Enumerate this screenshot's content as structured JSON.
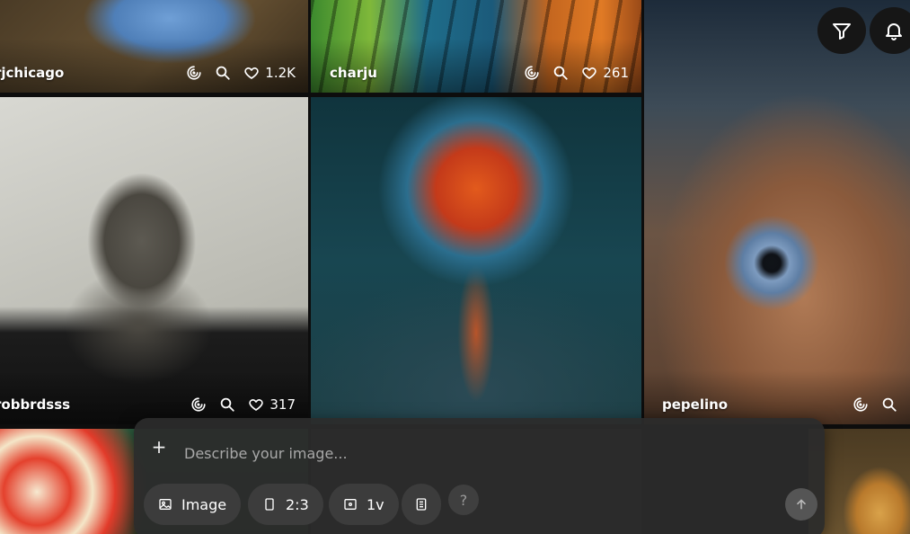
{
  "tiles": [
    {
      "author": "rjchicago",
      "likes": "1.2K"
    },
    {
      "author": "charju",
      "likes": "261"
    },
    {
      "author": "robbrdsss",
      "likes": "317"
    },
    {
      "author": "pepelino",
      "likes": ""
    }
  ],
  "controls": {
    "filter_icon": "filter-icon",
    "bell_icon": "bell-icon"
  },
  "prompt": {
    "placeholder": "Describe your image...",
    "plus_label": "+",
    "chips": [
      {
        "label": "Image",
        "icon": "image-icon"
      },
      {
        "label": "2:3",
        "icon": "aspect-ratio-icon"
      },
      {
        "label": "1v",
        "icon": "variations-icon"
      }
    ],
    "help_label": "?",
    "send_icon": "arrow-up-icon"
  }
}
